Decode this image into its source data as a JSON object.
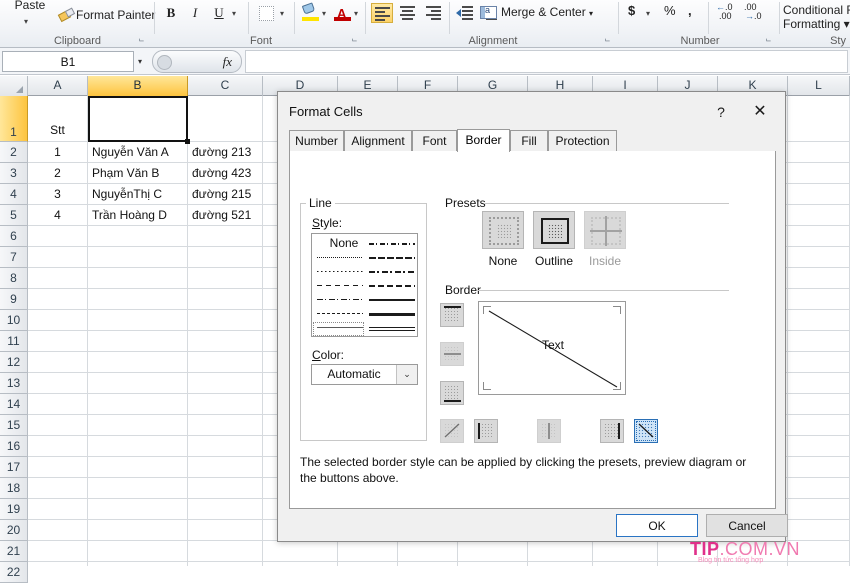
{
  "ribbon": {
    "clipboard": {
      "group_label": "Clipboard",
      "paste_label": "Paste",
      "format_painter_label": "Format Painter"
    },
    "font": {
      "group_label": "Font",
      "bold": "B",
      "italic": "I",
      "underline": "U",
      "borders_icon": "borders-icon",
      "fill_color_icon": "fill-color-icon",
      "font_color_letter": "A"
    },
    "alignment": {
      "group_label": "Alignment",
      "align_left": "align-left-icon",
      "align_center": "align-center-icon",
      "align_right": "align-right-icon",
      "decrease_indent": "decrease-indent-icon",
      "increase_indent": "increase-indent-icon",
      "merge_center_label": "Merge & Center"
    },
    "number": {
      "group_label": "Number",
      "currency": "$",
      "percent": "%",
      "comma": ",",
      "increase_decimal": ".00",
      "decrease_decimal": ".00"
    },
    "styles": {
      "group_label": "Sty",
      "conditional_formatting_line1": "Conditional    F",
      "conditional_formatting_line2": "Formatting ▾ as"
    }
  },
  "formula_bar": {
    "name_box_value": "B1",
    "fx_label": "fx",
    "formula_value": ""
  },
  "grid": {
    "columns": [
      "A",
      "B",
      "C",
      "D",
      "E",
      "F",
      "G",
      "H",
      "I",
      "J",
      "K",
      "L"
    ],
    "selected_column": "B",
    "rows": [
      "1",
      "2",
      "3",
      "4",
      "5",
      "6",
      "7",
      "8",
      "9",
      "10",
      "11",
      "12",
      "13",
      "14",
      "15",
      "16",
      "17",
      "18",
      "19",
      "20",
      "21",
      "22"
    ],
    "selected_row": "1",
    "active_cell": "B1",
    "data": [
      {
        "row": "1",
        "A": "Stt",
        "B": "",
        "C": ""
      },
      {
        "row": "2",
        "A": "1",
        "B": "Nguyễn Văn A",
        "C": "đường 213"
      },
      {
        "row": "3",
        "A": "2",
        "B": "Phạm Văn B",
        "C": "đường 423"
      },
      {
        "row": "4",
        "A": "3",
        "B": "NguyễnThị C",
        "C": "đường 215"
      },
      {
        "row": "5",
        "A": "4",
        "B": "Trần Hoàng D",
        "C": "đường 521"
      }
    ]
  },
  "dialog": {
    "title": "Format Cells",
    "help_glyph": "?",
    "close_glyph": "✕",
    "tabs": [
      {
        "label": "Number",
        "active": false
      },
      {
        "label": "Alignment",
        "active": false
      },
      {
        "label": "Font",
        "active": false
      },
      {
        "label": "Border",
        "active": true
      },
      {
        "label": "Fill",
        "active": false
      },
      {
        "label": "Protection",
        "active": false
      }
    ],
    "line": {
      "group_label": "Line",
      "style_label": "Style:",
      "none_label": "None",
      "color_label": "Color:",
      "color_value": "Automatic",
      "styles_left": [
        "none",
        "dotted-fine",
        "dotted",
        "dashed-wide",
        "dash-dot-long",
        "dashed-medium",
        "hairline-selected"
      ],
      "styles_right": [
        "dash-dot",
        "slanted-dash",
        "dash-dot-bold",
        "dashed-bold",
        "thin-solid",
        "thick-solid",
        "double"
      ]
    },
    "presets": {
      "group_label": "Presets",
      "items": [
        {
          "label": "None",
          "name": "preset-none",
          "enabled": true
        },
        {
          "label": "Outline",
          "name": "preset-outline",
          "enabled": true
        },
        {
          "label": "Inside",
          "name": "preset-inside",
          "enabled": false
        }
      ]
    },
    "border": {
      "group_label": "Border",
      "preview_text": "Text",
      "side_buttons": [
        "border-top",
        "border-horizontal-inside",
        "border-bottom"
      ],
      "bottom_buttons": [
        "border-diagonal-up",
        "border-left",
        "border-vertical-inside",
        "border-right",
        "border-diagonal-down"
      ],
      "selected_button": "border-diagonal-down"
    },
    "description": "The selected border style can be applied by clicking the presets, preview diagram or the buttons above.",
    "ok_label": "OK",
    "cancel_label": "Cancel"
  },
  "watermark": {
    "brand": "TIP",
    "domain": ".COM.VN",
    "tagline": "Blog tin tức tổng hợp",
    "brand_color": "#e0308a"
  }
}
